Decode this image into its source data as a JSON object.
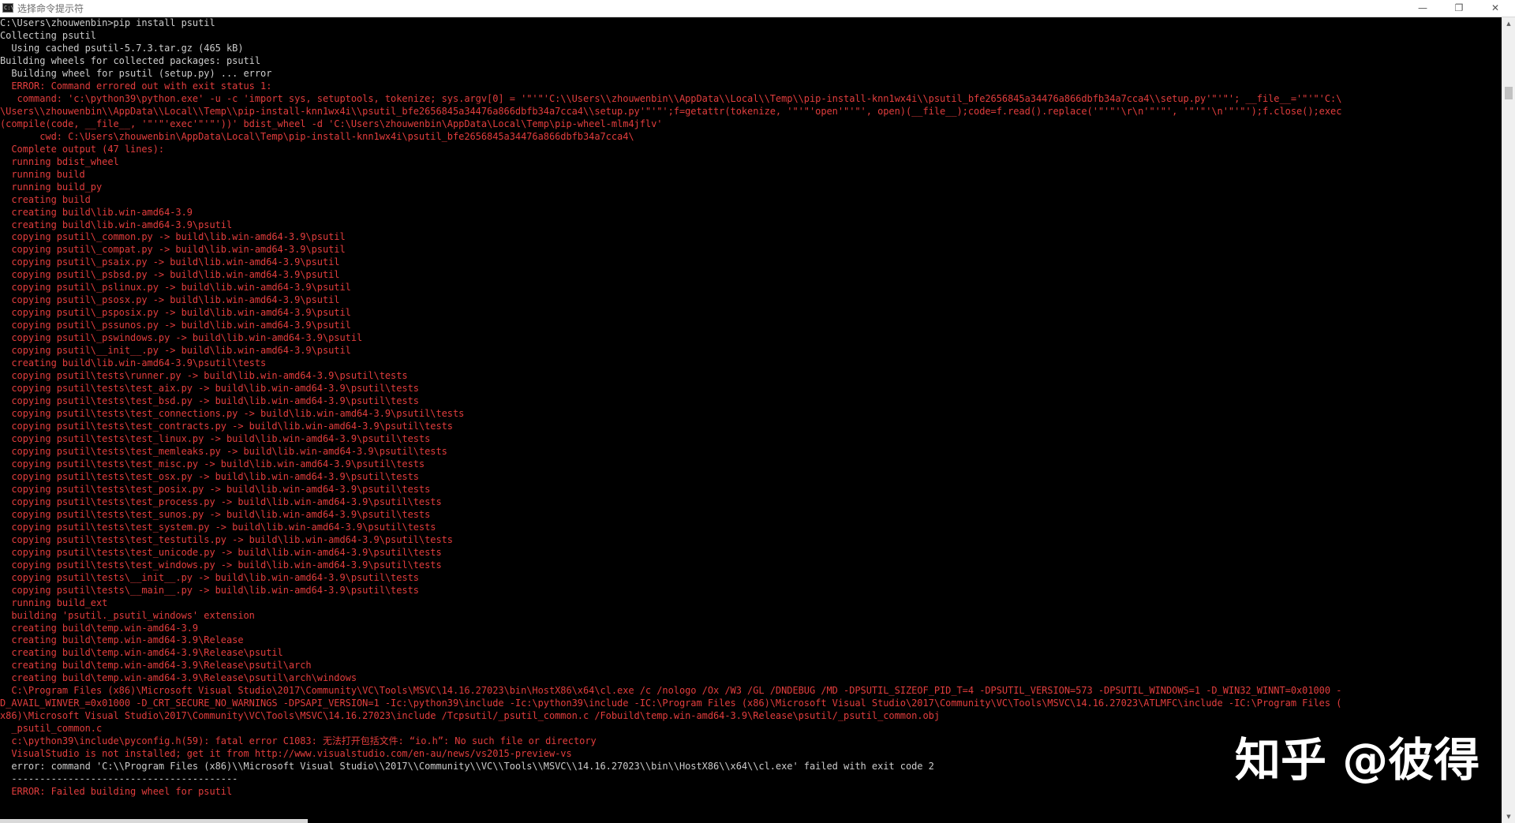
{
  "window": {
    "title": "选择命令提示符",
    "icon": "cmd-icon",
    "icon_text": "C:\\",
    "controls": {
      "minimize": "—",
      "maximize": "❐",
      "close": "✕"
    }
  },
  "colors": {
    "background": "#000000",
    "default_text": "#cccccc",
    "error_text": "#e23d3d",
    "scrollbar": "#f0f0f0"
  },
  "console": {
    "lines": [
      {
        "text": "C:\\Users\\zhouwenbin>pip install psutil",
        "color": "default"
      },
      {
        "text": "Collecting psutil",
        "color": "default"
      },
      {
        "text": "  Using cached psutil-5.7.3.tar.gz (465 kB)",
        "color": "default"
      },
      {
        "text": "Building wheels for collected packages: psutil",
        "color": "default"
      },
      {
        "text": "  Building wheel for psutil (setup.py) ... error",
        "color": "default"
      },
      {
        "text": "  ERROR: Command errored out with exit status 1:",
        "color": "error"
      },
      {
        "text": "   command: 'c:\\python39\\python.exe' -u -c 'import sys, setuptools, tokenize; sys.argv[0] = '\"'\"'C:\\\\Users\\\\zhouwenbin\\\\AppData\\\\Local\\\\Temp\\\\pip-install-knn1wx4i\\\\psutil_bfe2656845a34476a866dbfb34a7cca4\\\\setup.py'\"'\"'; __file__='\"'\"'C:\\",
        "color": "error"
      },
      {
        "text": "\\Users\\\\zhouwenbin\\\\AppData\\\\Local\\\\Temp\\\\pip-install-knn1wx4i\\\\psutil_bfe2656845a34476a866dbfb34a7cca4\\\\setup.py'\"'\"';f=getattr(tokenize, '\"'\"'open'\"'\"', open)(__file__);code=f.read().replace('\"'\"'\\r\\n'\"'\"', '\"'\"'\\n'\"'\"');f.close();exec",
        "color": "error"
      },
      {
        "text": "(compile(code, __file__, '\"'\"'exec'\"'\"'))' bdist_wheel -d 'C:\\Users\\zhouwenbin\\AppData\\Local\\Temp\\pip-wheel-mlm4jflv'",
        "color": "error"
      },
      {
        "text": "       cwd: C:\\Users\\zhouwenbin\\AppData\\Local\\Temp\\pip-install-knn1wx4i\\psutil_bfe2656845a34476a866dbfb34a7cca4\\",
        "color": "error"
      },
      {
        "text": "  Complete output (47 lines):",
        "color": "error"
      },
      {
        "text": "  running bdist_wheel",
        "color": "error"
      },
      {
        "text": "  running build",
        "color": "error"
      },
      {
        "text": "  running build_py",
        "color": "error"
      },
      {
        "text": "  creating build",
        "color": "error"
      },
      {
        "text": "  creating build\\lib.win-amd64-3.9",
        "color": "error"
      },
      {
        "text": "  creating build\\lib.win-amd64-3.9\\psutil",
        "color": "error"
      },
      {
        "text": "  copying psutil\\_common.py -> build\\lib.win-amd64-3.9\\psutil",
        "color": "error"
      },
      {
        "text": "  copying psutil\\_compat.py -> build\\lib.win-amd64-3.9\\psutil",
        "color": "error"
      },
      {
        "text": "  copying psutil\\_psaix.py -> build\\lib.win-amd64-3.9\\psutil",
        "color": "error"
      },
      {
        "text": "  copying psutil\\_psbsd.py -> build\\lib.win-amd64-3.9\\psutil",
        "color": "error"
      },
      {
        "text": "  copying psutil\\_pslinux.py -> build\\lib.win-amd64-3.9\\psutil",
        "color": "error"
      },
      {
        "text": "  copying psutil\\_psosx.py -> build\\lib.win-amd64-3.9\\psutil",
        "color": "error"
      },
      {
        "text": "  copying psutil\\_psposix.py -> build\\lib.win-amd64-3.9\\psutil",
        "color": "error"
      },
      {
        "text": "  copying psutil\\_pssunos.py -> build\\lib.win-amd64-3.9\\psutil",
        "color": "error"
      },
      {
        "text": "  copying psutil\\_pswindows.py -> build\\lib.win-amd64-3.9\\psutil",
        "color": "error"
      },
      {
        "text": "  copying psutil\\__init__.py -> build\\lib.win-amd64-3.9\\psutil",
        "color": "error"
      },
      {
        "text": "  creating build\\lib.win-amd64-3.9\\psutil\\tests",
        "color": "error"
      },
      {
        "text": "  copying psutil\\tests\\runner.py -> build\\lib.win-amd64-3.9\\psutil\\tests",
        "color": "error"
      },
      {
        "text": "  copying psutil\\tests\\test_aix.py -> build\\lib.win-amd64-3.9\\psutil\\tests",
        "color": "error"
      },
      {
        "text": "  copying psutil\\tests\\test_bsd.py -> build\\lib.win-amd64-3.9\\psutil\\tests",
        "color": "error"
      },
      {
        "text": "  copying psutil\\tests\\test_connections.py -> build\\lib.win-amd64-3.9\\psutil\\tests",
        "color": "error"
      },
      {
        "text": "  copying psutil\\tests\\test_contracts.py -> build\\lib.win-amd64-3.9\\psutil\\tests",
        "color": "error"
      },
      {
        "text": "  copying psutil\\tests\\test_linux.py -> build\\lib.win-amd64-3.9\\psutil\\tests",
        "color": "error"
      },
      {
        "text": "  copying psutil\\tests\\test_memleaks.py -> build\\lib.win-amd64-3.9\\psutil\\tests",
        "color": "error"
      },
      {
        "text": "  copying psutil\\tests\\test_misc.py -> build\\lib.win-amd64-3.9\\psutil\\tests",
        "color": "error"
      },
      {
        "text": "  copying psutil\\tests\\test_osx.py -> build\\lib.win-amd64-3.9\\psutil\\tests",
        "color": "error"
      },
      {
        "text": "  copying psutil\\tests\\test_posix.py -> build\\lib.win-amd64-3.9\\psutil\\tests",
        "color": "error"
      },
      {
        "text": "  copying psutil\\tests\\test_process.py -> build\\lib.win-amd64-3.9\\psutil\\tests",
        "color": "error"
      },
      {
        "text": "  copying psutil\\tests\\test_sunos.py -> build\\lib.win-amd64-3.9\\psutil\\tests",
        "color": "error"
      },
      {
        "text": "  copying psutil\\tests\\test_system.py -> build\\lib.win-amd64-3.9\\psutil\\tests",
        "color": "error"
      },
      {
        "text": "  copying psutil\\tests\\test_testutils.py -> build\\lib.win-amd64-3.9\\psutil\\tests",
        "color": "error"
      },
      {
        "text": "  copying psutil\\tests\\test_unicode.py -> build\\lib.win-amd64-3.9\\psutil\\tests",
        "color": "error"
      },
      {
        "text": "  copying psutil\\tests\\test_windows.py -> build\\lib.win-amd64-3.9\\psutil\\tests",
        "color": "error"
      },
      {
        "text": "  copying psutil\\tests\\__init__.py -> build\\lib.win-amd64-3.9\\psutil\\tests",
        "color": "error"
      },
      {
        "text": "  copying psutil\\tests\\__main__.py -> build\\lib.win-amd64-3.9\\psutil\\tests",
        "color": "error"
      },
      {
        "text": "  running build_ext",
        "color": "error"
      },
      {
        "text": "  building 'psutil._psutil_windows' extension",
        "color": "error"
      },
      {
        "text": "  creating build\\temp.win-amd64-3.9",
        "color": "error"
      },
      {
        "text": "  creating build\\temp.win-amd64-3.9\\Release",
        "color": "error"
      },
      {
        "text": "  creating build\\temp.win-amd64-3.9\\Release\\psutil",
        "color": "error"
      },
      {
        "text": "  creating build\\temp.win-amd64-3.9\\Release\\psutil\\arch",
        "color": "error"
      },
      {
        "text": "  creating build\\temp.win-amd64-3.9\\Release\\psutil\\arch\\windows",
        "color": "error"
      },
      {
        "text": "  C:\\Program Files (x86)\\Microsoft Visual Studio\\2017\\Community\\VC\\Tools\\MSVC\\14.16.27023\\bin\\HostX86\\x64\\cl.exe /c /nologo /Ox /W3 /GL /DNDEBUG /MD -DPSUTIL_SIZEOF_PID_T=4 -DPSUTIL_VERSION=573 -DPSUTIL_WINDOWS=1 -D_WIN32_WINNT=0x01000 -",
        "color": "error"
      },
      {
        "text": "D_AVAIL_WINVER_=0x01000 -D_CRT_SECURE_NO_WARNINGS -DPSAPI_VERSION=1 -Ic:\\python39\\include -Ic:\\python39\\include -IC:\\Program Files (x86)\\Microsoft Visual Studio\\2017\\Community\\VC\\Tools\\MSVC\\14.16.27023\\ATLMFC\\include -IC:\\Program Files (",
        "color": "error"
      },
      {
        "text": "x86)\\Microsoft Visual Studio\\2017\\Community\\VC\\Tools\\MSVC\\14.16.27023\\include /Tcpsutil/_psutil_common.c /Fobuild\\temp.win-amd64-3.9\\Release\\psutil/_psutil_common.obj",
        "color": "error"
      },
      {
        "text": "  _psutil_common.c",
        "color": "error"
      },
      {
        "text": "  c:\\python39\\include\\pyconfig.h(59): fatal error C1083: 无法打开包括文件: “io.h”: No such file or directory",
        "color": "error"
      },
      {
        "text": "  VisualStudio is not installed; get it from http://www.visualstudio.com/en-au/news/vs2015-preview-vs",
        "color": "error"
      },
      {
        "text": "  error: command 'C:\\\\Program Files (x86)\\\\Microsoft Visual Studio\\\\2017\\\\Community\\\\VC\\\\Tools\\\\MSVC\\\\14.16.27023\\\\bin\\\\HostX86\\\\x64\\\\cl.exe' failed with exit code 2",
        "color": "default"
      },
      {
        "text": "  ----------------------------------------",
        "color": "default"
      },
      {
        "text": "  ERROR: Failed building wheel for psutil",
        "color": "error"
      }
    ]
  },
  "watermark": {
    "text": "知乎 @彼得"
  },
  "scrollbar": {
    "up_arrow": "▲",
    "down_arrow": "▼"
  }
}
